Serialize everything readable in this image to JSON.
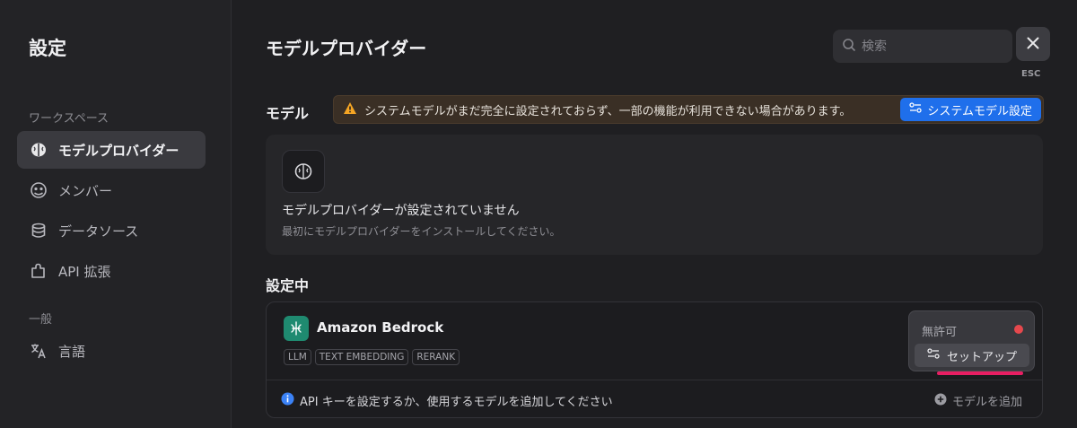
{
  "sidebar": {
    "title": "設定",
    "workspace_label": "ワークスペース",
    "general_label": "一般",
    "items": [
      {
        "label": "モデルプロバイダー",
        "icon": "brain-icon",
        "active": true
      },
      {
        "label": "メンバー",
        "icon": "members-icon",
        "active": false
      },
      {
        "label": "データソース",
        "icon": "database-icon",
        "active": false
      },
      {
        "label": "API 拡張",
        "icon": "puzzle-icon",
        "active": false
      },
      {
        "label": "言語",
        "icon": "translate-icon",
        "active": false
      }
    ]
  },
  "header": {
    "title": "モデルプロバイダー",
    "search_placeholder": "検索",
    "esc_label": "ESC"
  },
  "model_section": {
    "label": "モデル",
    "warning_text": "システムモデルがまだ完全に設定されておらず、一部の機能が利用できない場合があります。",
    "system_model_button": "システムモデル設定",
    "empty_title": "モデルプロバイダーが設定されていません",
    "empty_desc": "最初にモデルプロバイダーをインストールしてください。"
  },
  "configured_section": {
    "label": "設定中",
    "provider": {
      "name": "Amazon Bedrock",
      "tags": [
        "LLM",
        "TEXT EMBEDDING",
        "RERANK"
      ],
      "status": "無許可",
      "setup_button": "セットアップ",
      "info_text": "API キーを設定するか、使用するモデルを追加してください",
      "add_model": "モデルを追加"
    }
  },
  "colors": {
    "accent": "#1f6feb",
    "warning_icon": "#f5a524",
    "status_dot": "#e5484d",
    "provider_logo": "#1f8a70",
    "annotation_underline": "#e91e63"
  }
}
